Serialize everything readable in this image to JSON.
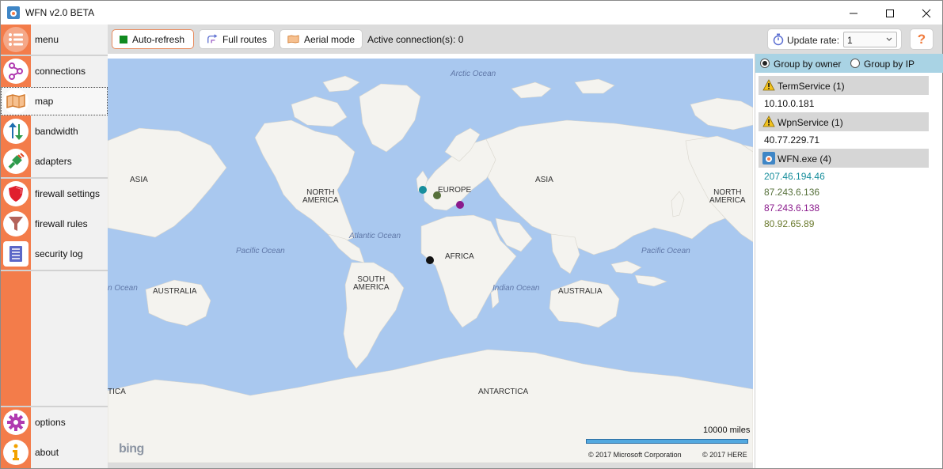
{
  "window": {
    "title": "WFN v2.0 BETA"
  },
  "sidebar": {
    "items": [
      {
        "label": "menu"
      },
      {
        "label": "connections"
      },
      {
        "label": "map"
      },
      {
        "label": "bandwidth"
      },
      {
        "label": "adapters"
      },
      {
        "label": "firewall settings"
      },
      {
        "label": "firewall rules"
      },
      {
        "label": "security log"
      },
      {
        "label": "options"
      },
      {
        "label": "about"
      }
    ]
  },
  "toolbar": {
    "auto_refresh": "Auto-refresh",
    "full_routes": "Full routes",
    "aerial_mode": "Aerial mode",
    "active_connections": "Active connection(s): 0",
    "update_rate_label": "Update rate:",
    "update_rate_value": "1",
    "help": "?"
  },
  "map": {
    "continents": [
      "ASIA",
      "NORTH\nAMERICA",
      "EUROPE",
      "ASIA",
      "NORTH\nAMERICA",
      "AFRICA",
      "SOUTH\nAMERICA",
      "AUSTRALIA",
      "AUSTRALIA",
      "ANTARCTICA",
      "TICA"
    ],
    "oceans": [
      "Arctic Ocean",
      "Atlantic Ocean",
      "Pacific Ocean",
      "Pacific Ocean",
      "Indian Ocean",
      "n Ocean"
    ],
    "scale": "10000 miles",
    "copyright_ms": "© 2017 Microsoft Corporation",
    "copyright_here": "© 2017 HERE",
    "logo": "bing",
    "dot_colors": [
      "#178e9c",
      "#56703a",
      "#8a1a8c",
      "#111111"
    ]
  },
  "panel": {
    "group_by_owner": "Group by owner",
    "group_by_ip": "Group by IP",
    "groups": [
      {
        "name": "TermService (1)",
        "ips": [
          {
            "ip": "10.10.0.181",
            "color": "#111111"
          }
        ]
      },
      {
        "name": "WpnService (1)",
        "ips": [
          {
            "ip": "40.77.229.71",
            "color": "#111111"
          }
        ]
      },
      {
        "name": "WFN.exe (4)",
        "ips": [
          {
            "ip": "207.46.194.46",
            "color": "#178e9c"
          },
          {
            "ip": "87.243.6.136",
            "color": "#56703a"
          },
          {
            "ip": "87.243.6.138",
            "color": "#8a1a8c"
          },
          {
            "ip": "80.92.65.89",
            "color": "#6b7a2e"
          }
        ]
      }
    ]
  },
  "colors": {
    "accent": "#f37c4a",
    "map_water": "#a9c8ef",
    "map_land": "#f4f3ef",
    "group_bar": "#a9d3e4"
  }
}
